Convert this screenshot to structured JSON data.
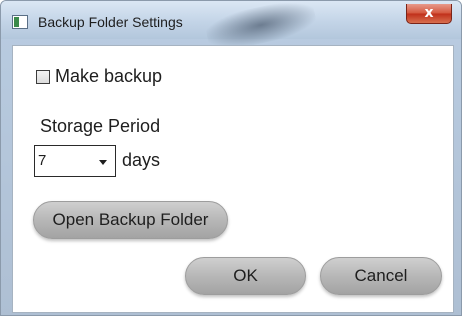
{
  "window": {
    "title": "Backup Folder Settings",
    "close_label": "x"
  },
  "settings": {
    "make_backup_label": "Make backup",
    "make_backup_checked": false,
    "storage_period_label": "Storage Period",
    "storage_period_value": "7",
    "days_label": "days",
    "open_folder_label": "Open Backup Folder"
  },
  "actions": {
    "ok_label": "OK",
    "cancel_label": "Cancel"
  }
}
